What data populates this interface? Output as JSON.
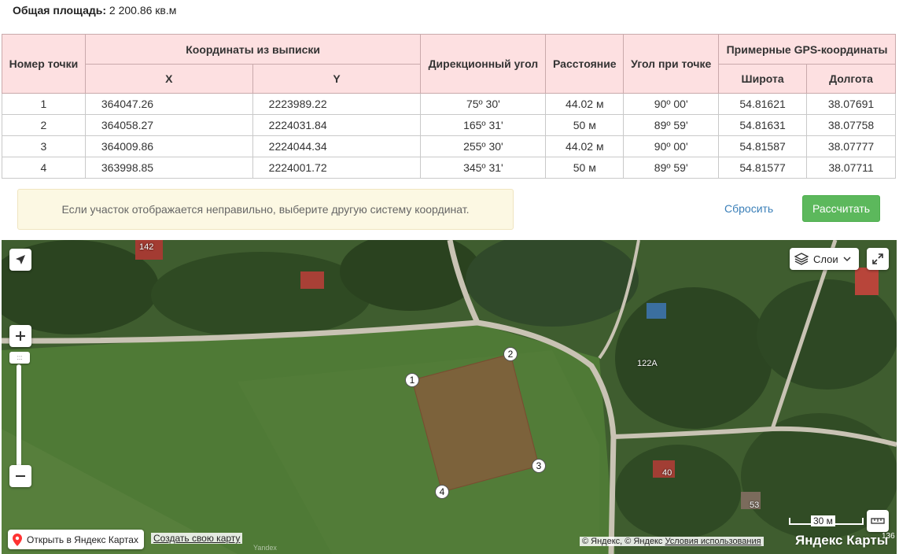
{
  "area": {
    "label": "Общая площадь:",
    "value": "2 200.86 кв.м"
  },
  "table": {
    "headers": {
      "point_no": "Номер точки",
      "coords_group": "Координаты из выписки",
      "x": "X",
      "y": "Y",
      "bearing": "Дирекционный угол",
      "distance": "Расстояние",
      "angle": "Угол при точке",
      "gps_group": "Примерные GPS-координаты",
      "lat": "Широта",
      "lon": "Долгота"
    },
    "rows": [
      {
        "n": "1",
        "x": "364047.26",
        "y": "2223989.22",
        "bearing": "75º 30'",
        "distance": "44.02 м",
        "angle": "90º 00'",
        "lat": "54.81621",
        "lon": "38.07691"
      },
      {
        "n": "2",
        "x": "364058.27",
        "y": "2224031.84",
        "bearing": "165º 31'",
        "distance": "50 м",
        "angle": "89º 59'",
        "lat": "54.81631",
        "lon": "38.07758"
      },
      {
        "n": "3",
        "x": "364009.86",
        "y": "2224044.34",
        "bearing": "255º 30'",
        "distance": "44.02 м",
        "angle": "90º 00'",
        "lat": "54.81587",
        "lon": "38.07777"
      },
      {
        "n": "4",
        "x": "363998.85",
        "y": "2224001.72",
        "bearing": "345º 31'",
        "distance": "50 м",
        "angle": "89º 59'",
        "lat": "54.81577",
        "lon": "38.07711"
      }
    ]
  },
  "notice": "Если участок отображается неправильно, выберите другую систему координат.",
  "buttons": {
    "reset": "Сбросить",
    "calculate": "Рассчитать"
  },
  "map": {
    "layers_label": "Слои",
    "open_in_yandex": "Открыть в Яндекс Картах",
    "create_map": "Создать свою карту",
    "watermark": "Yandex",
    "copyright": "© Яндекс, © Яндекс",
    "terms": "Условия использования",
    "brand": "Яндекс Карты",
    "scale": "30 м",
    "scale_tail": "136",
    "house_labels": {
      "h142": "142",
      "h122a": "122А",
      "h40": "40",
      "h53": "53"
    },
    "plot_points": [
      "1",
      "2",
      "3",
      "4"
    ],
    "zoom_handle": ":::",
    "colors": {
      "plot_fill": "#8b5a3c",
      "field": "#4f7a36",
      "road": "#c9c3b4"
    }
  }
}
